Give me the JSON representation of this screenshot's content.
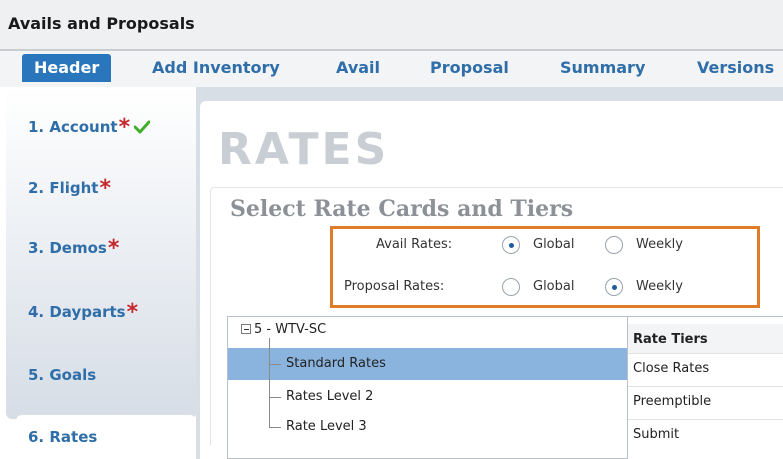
{
  "app": {
    "title": "Avails and Proposals"
  },
  "tabs": [
    {
      "label": "Header"
    },
    {
      "label": "Add Inventory"
    },
    {
      "label": "Avail"
    },
    {
      "label": "Proposal"
    },
    {
      "label": "Summary"
    },
    {
      "label": "Versions"
    }
  ],
  "sidebar": {
    "items": [
      {
        "label": "1. Account",
        "required": "*"
      },
      {
        "label": "2. Flight",
        "required": "*"
      },
      {
        "label": "3. Demos",
        "required": "*"
      },
      {
        "label": "4. Dayparts",
        "required": "*"
      },
      {
        "label": "5. Goals"
      },
      {
        "label": "6. Rates"
      }
    ]
  },
  "main": {
    "page_title": "RATES",
    "section_title": "Select Rate Cards and Tiers",
    "rate_options": [
      {
        "label": "Avail Rates:",
        "selected": "Global",
        "options": [
          "Global",
          "Weekly"
        ]
      },
      {
        "label": "Proposal Rates:",
        "selected": "Weekly",
        "options": [
          "Global",
          "Weekly"
        ]
      }
    ],
    "tree": {
      "root": "5 - WTV-SC",
      "nodes": [
        "Standard Rates",
        "Rates Level 2",
        "Rate Level 3"
      ],
      "selected": "Standard Rates"
    },
    "tiers": {
      "header": "Rate Tiers",
      "rows": [
        "Close Rates",
        "Preemptible",
        "Submit"
      ]
    }
  },
  "colors": {
    "accent_blue": "#2a76bd",
    "required_red": "#c4282d",
    "highlight_orange": "#e07b27",
    "selection_blue": "#8ab4de"
  }
}
